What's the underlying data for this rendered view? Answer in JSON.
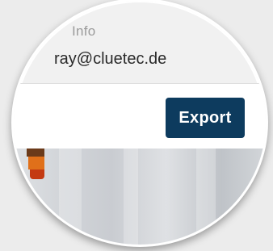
{
  "contact": {
    "field_label": "Info",
    "email_value": "ray@cluetec.de"
  },
  "actions": {
    "export_label": "Export"
  },
  "colors": {
    "button_bg": "#0d3b5e",
    "button_text": "#ffffff",
    "card_bg": "#ffffff",
    "page_bg": "#f1f1f1"
  }
}
